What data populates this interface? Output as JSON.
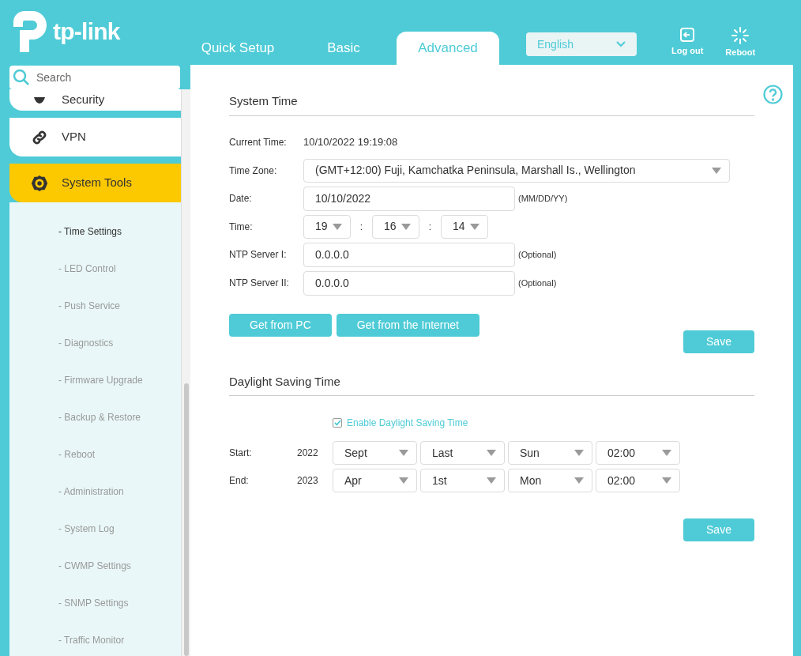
{
  "header": {
    "logo_text": "tp-link",
    "tabs": [
      {
        "label": "Quick Setup",
        "selected": false
      },
      {
        "label": "Basic",
        "selected": false
      },
      {
        "label": "Advanced",
        "selected": true
      }
    ],
    "language": {
      "value": "English"
    },
    "actions": [
      {
        "kind": "logout",
        "label": "Log out"
      },
      {
        "kind": "reboot",
        "label": "Reboot"
      }
    ]
  },
  "sidebar": {
    "search": {
      "placeholder": "Search"
    },
    "items": [
      {
        "label": "Security",
        "kind": "shield",
        "selected": false
      },
      {
        "label": "VPN",
        "kind": "link",
        "selected": false
      },
      {
        "label": "System Tools",
        "kind": "gear",
        "selected": true,
        "expanded": true,
        "children": [
          {
            "label": "- Time Settings",
            "selected": true
          },
          {
            "label": "- LED Control",
            "selected": false
          },
          {
            "label": "- Push Service",
            "selected": false
          },
          {
            "label": "- Diagnostics",
            "selected": false
          },
          {
            "label": "- Firmware Upgrade",
            "selected": false
          },
          {
            "label": "- Backup & Restore",
            "selected": false
          },
          {
            "label": "- Reboot",
            "selected": false
          },
          {
            "label": "- Administration",
            "selected": false
          },
          {
            "label": "- System Log",
            "selected": false
          },
          {
            "label": "- CWMP Settings",
            "selected": false
          },
          {
            "label": "- SNMP Settings",
            "selected": false
          },
          {
            "label": "- Traffic Monitor",
            "selected": false
          }
        ]
      }
    ]
  },
  "system_time": {
    "title": "System Time",
    "current_time": {
      "label": "Current Time:",
      "value": "10/10/2022 19:19:08"
    },
    "time_zone": {
      "label": "Time Zone:",
      "value": "(GMT+12:00) Fuji, Kamchatka Peninsula, Marshall Is., Wellington"
    },
    "date": {
      "label": "Date:",
      "value": "10/10/2022",
      "hint": "(MM/DD/YY)"
    },
    "time": {
      "label": "Time:",
      "parts": [
        "19",
        "16",
        "14"
      ],
      "separators": [
        ":",
        ":"
      ]
    },
    "ntp": [
      {
        "label": "NTP Server I:",
        "value": "0.0.0.0",
        "hint": "(Optional)"
      },
      {
        "label": "NTP Server II:",
        "value": "0.0.0.0",
        "hint": "(Optional)"
      }
    ],
    "buttons": [
      "Get from PC",
      "Get from the Internet"
    ],
    "save": "Save"
  },
  "daylight_saving": {
    "title": "Daylight Saving Time",
    "enable": {
      "label": "Enable Daylight Saving Time",
      "checked": true
    },
    "rows": [
      {
        "label": "Start:",
        "year": "2022",
        "selects": [
          "Sept",
          "Last",
          "Sun",
          "02:00"
        ]
      },
      {
        "label": "End:",
        "year": "2023",
        "selects": [
          "Apr",
          "1st",
          "Mon",
          "02:00"
        ]
      }
    ],
    "save": "Save"
  }
}
